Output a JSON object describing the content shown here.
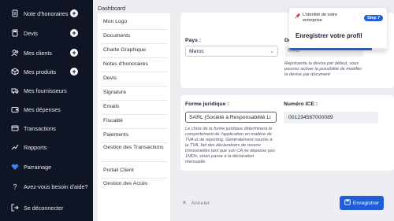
{
  "sidebar": {
    "items": [
      {
        "label": "Note d'honoraires",
        "icon": "document-icon",
        "plus": true
      },
      {
        "label": "Devis",
        "icon": "calculator-icon",
        "plus": true
      },
      {
        "label": "Mes clients",
        "icon": "users-icon",
        "plus": true
      },
      {
        "label": "Mes produits",
        "icon": "box-icon",
        "plus": true
      },
      {
        "label": "Mes fournisseurs",
        "icon": "truck-icon",
        "plus": false
      },
      {
        "label": "Mes dépenses",
        "icon": "wallet-icon",
        "plus": false
      },
      {
        "label": "Transactions",
        "icon": "card-icon",
        "plus": false
      },
      {
        "label": "Rapports",
        "icon": "chart-icon",
        "plus": false
      },
      {
        "label": "Parrainage",
        "icon": "heart-icon",
        "plus": false
      },
      {
        "label": "Avez-vous besoin d'aide?",
        "icon": "help-icon",
        "plus": false
      },
      {
        "label": "Se déconnecter",
        "icon": "logout-icon",
        "plus": false
      }
    ]
  },
  "header": {
    "breadcrumb": "Dashboard"
  },
  "submenu": {
    "items": [
      "Mon Logo",
      "Documents",
      "Charte Graphique",
      "Notes d'honoraires",
      "Devis",
      "Signature",
      "Emails",
      "Fiscalité",
      "Paiements",
      "Gestion des Transactions",
      "Portail Client",
      "Gestion des Accès"
    ]
  },
  "form": {
    "pays_label": "Pays :",
    "pays_value": "Maroc",
    "devise_label": "De",
    "devise_value": "MAD",
    "devise_hint": "Représente la devise par défaut, vous pourrez activer la possibilité de modifier la devise par document",
    "forme_label": "Forme juridique :",
    "forme_value": "SARL (Société à Responsabilité Li",
    "forme_hint": "Le choix de la forme juridique déterminera le comportement de l'application en matière de TVA et de reporting. Généralement soumis à la TVA, fait des déclarations de revenu trimestrielles tant que son CA ne dépasse pas 1MDh, sinon passe à la déclaration mensuelle",
    "ice_label": "Numéro ICE :",
    "ice_value": "001234567000089"
  },
  "footer": {
    "cancel_label": "Annuler",
    "save_label": "Enregistrer"
  },
  "onboarding": {
    "kicker": "L'identité de votre entreprise",
    "step": "Step 7",
    "title": "Enregistrer votre profil",
    "progress": 0.85
  },
  "colors": {
    "accent": "#1f5ed6",
    "sidebar_bg": "#0f1524",
    "heart": "#3b82f6"
  }
}
